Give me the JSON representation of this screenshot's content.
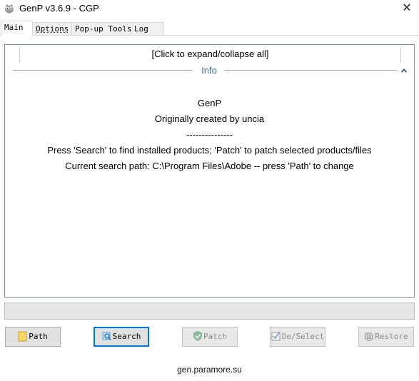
{
  "window": {
    "title": "GenP v3.6.9 - CGP",
    "close_glyph": "✕",
    "icon": "app-icon"
  },
  "tabs": [
    {
      "label": "Main",
      "active": true
    },
    {
      "label": "Options",
      "active": false
    },
    {
      "label": "Pop-up Tools",
      "active": false
    },
    {
      "label": "Log",
      "active": false
    }
  ],
  "info_panel": {
    "expand_toggle": "[Click to expand/collapse all]",
    "section_title": "Info",
    "collapse_glyph": "^",
    "lines": [
      "GenP",
      "Originally created by uncia",
      "---------------",
      "Press 'Search' to find installed products; 'Patch' to patch selected products/files",
      "Current search path: C:\\Program Files\\Adobe -- press 'Path' to change"
    ]
  },
  "progress": {
    "value": 0
  },
  "buttons": {
    "path": {
      "label": "Path",
      "icon": "folder-icon",
      "enabled": true
    },
    "search": {
      "label": "Search",
      "icon": "search-icon",
      "enabled": true,
      "focused": true
    },
    "patch": {
      "label": "Patch",
      "icon": "shield-check-icon",
      "enabled": false
    },
    "deselect": {
      "label": "De/Select",
      "icon": "checkbox-icon",
      "enabled": false
    },
    "restore": {
      "label": "Restore",
      "icon": "restore-icon",
      "enabled": false
    }
  },
  "footer": {
    "link": "gen.paramore.su"
  },
  "colors": {
    "accent": "#0078d7",
    "info_title": "#3b6ea5",
    "disabled_text": "#8d8d8d"
  }
}
